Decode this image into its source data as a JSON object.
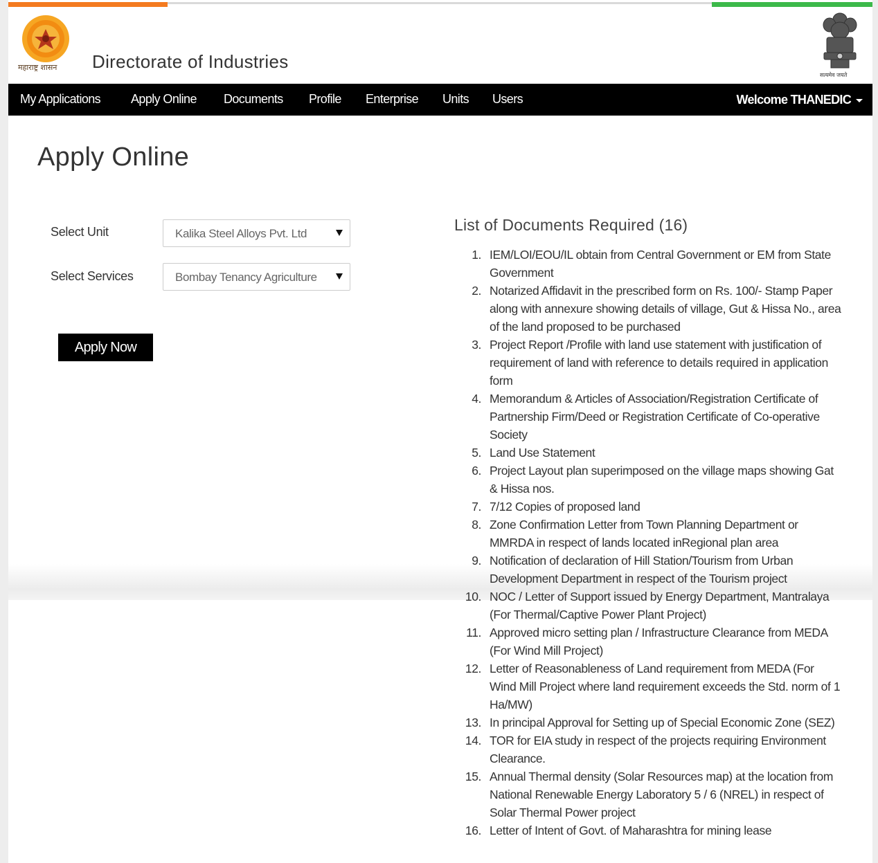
{
  "header": {
    "logo_caption": "महाराष्ट्र शासन",
    "site_title": "Directorate of Industries",
    "emblem_caption": "सत्यमेव जयते",
    "logo_icon": "maharashtra-seal-icon",
    "emblem_icon": "national-emblem-icon"
  },
  "colors": {
    "saffron": "#f47b20",
    "green": "#3cb94a",
    "navbar": "#000000",
    "button": "#000000"
  },
  "nav": {
    "items": [
      "My Applications",
      "Apply Online",
      "Documents",
      "Profile",
      "Enterprise",
      "Units",
      "Users"
    ],
    "welcome": "Welcome THANEDIC"
  },
  "page": {
    "title": "Apply Online"
  },
  "form": {
    "unit_label": "Select Unit",
    "unit_value": "Kalika Steel Alloys Pvt. Ltd",
    "services_label": "Select Services",
    "services_value": "Bombay Tenancy Agriculture",
    "apply_label": "Apply Now"
  },
  "documents": {
    "heading": "List of Documents Required (16)",
    "items": [
      "IEM/LOI/EOU/IL obtain from Central Government or EM from State Government",
      "Notarized Affidavit in the prescribed form on Rs. 100/- Stamp Paper along with annexure showing details of village, Gut & Hissa No., area of the land proposed to be purchased",
      "Project Report /Profile with land use statement with justification of requirement of land with reference to details required in application form",
      "Memorandum & Articles of Association/Registration Certificate of Partnership Firm/Deed or Registration Certificate of Co-operative Society",
      "Land Use Statement",
      "Project Layout plan superimposed on the village maps showing Gat & Hissa nos.",
      "7/12 Copies of proposed land",
      "Zone Confirmation Letter from Town Planning Department or MMRDA in respect of lands located inRegional plan area",
      "Notification of declaration of Hill Station/Tourism from Urban Development Department in respect of the Tourism project",
      "NOC / Letter of Support issued by Energy Department, Mantralaya (For Thermal/Captive Power Plant Project)",
      "Approved micro setting plan / Infrastructure Clearance from MEDA (For Wind Mill Project)",
      "Letter of Reasonableness of Land requirement from MEDA (For Wind Mill Project where land requirement exceeds the Std. norm of 1 Ha/MW)",
      "In principal Approval for Setting up of Special Economic Zone (SEZ)",
      "TOR for EIA study in respect of the projects requiring Environment Clearance.",
      "Annual Thermal density (Solar Resources map) at the location from National Renewable Energy Laboratory 5 / 6 (NREL) in respect of Solar Thermal Power project",
      "Letter of Intent of Govt. of Maharashtra for mining lease"
    ]
  }
}
